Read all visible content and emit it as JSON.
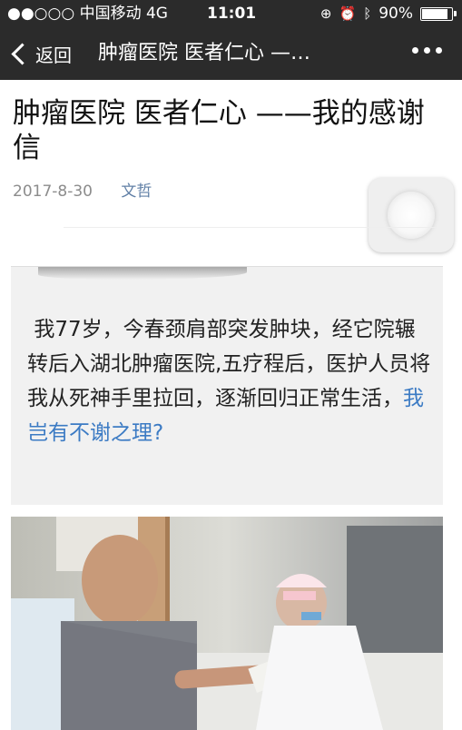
{
  "status_bar": {
    "carrier": "●●○○○ 中国移动  4G",
    "time": "11:01",
    "battery": "90%",
    "icons": [
      "screen-rotation-lock-icon",
      "alarm-icon",
      "bluetooth-icon",
      "battery-icon"
    ]
  },
  "nav": {
    "back_label": "返回",
    "title": "肿瘤医院 医者仁心 —…",
    "more_icon": "more-dots-icon"
  },
  "article": {
    "title": "肿瘤医院 医者仁心 ——我的感谢信",
    "date": "2017-8-30",
    "author": "文哲"
  },
  "quote": {
    "text_main": "我77岁，今春颈肩部突发肿块，经它院辗转后入湖北肿瘤医院,五疗程后，医护人员将我从死神手里拉回，逐渐回归正常生活，",
    "text_highlight": "我岂有不谢之理?"
  },
  "colors": {
    "nav_bg": "#2b2b2b",
    "author_link": "#607fa6",
    "highlight": "#3c7bc4"
  }
}
